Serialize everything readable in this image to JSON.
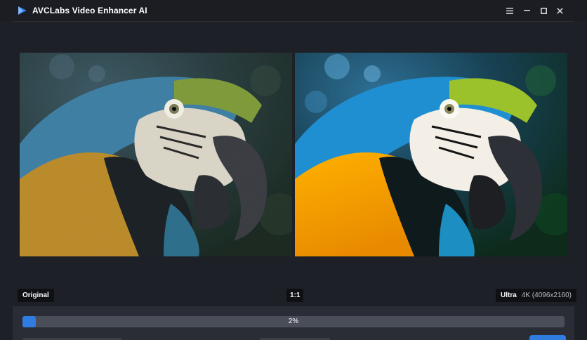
{
  "app": {
    "title": "AVCLabs Video Enhancer AI",
    "brand_color": "#2f7de1"
  },
  "window_controls": {
    "menu_icon": "hamburger-icon",
    "minimize_icon": "minimize-icon",
    "maximize_icon": "maximize-icon",
    "close_icon": "close-icon"
  },
  "preview": {
    "left_label": "Original",
    "ratio_label": "1:1",
    "right_label": "Ultra",
    "right_resolution": "4K (4096x2160)",
    "left_image": "parrot-original-image",
    "right_image": "parrot-enhanced-image"
  },
  "progress": {
    "percent": 2,
    "label": "2%"
  }
}
